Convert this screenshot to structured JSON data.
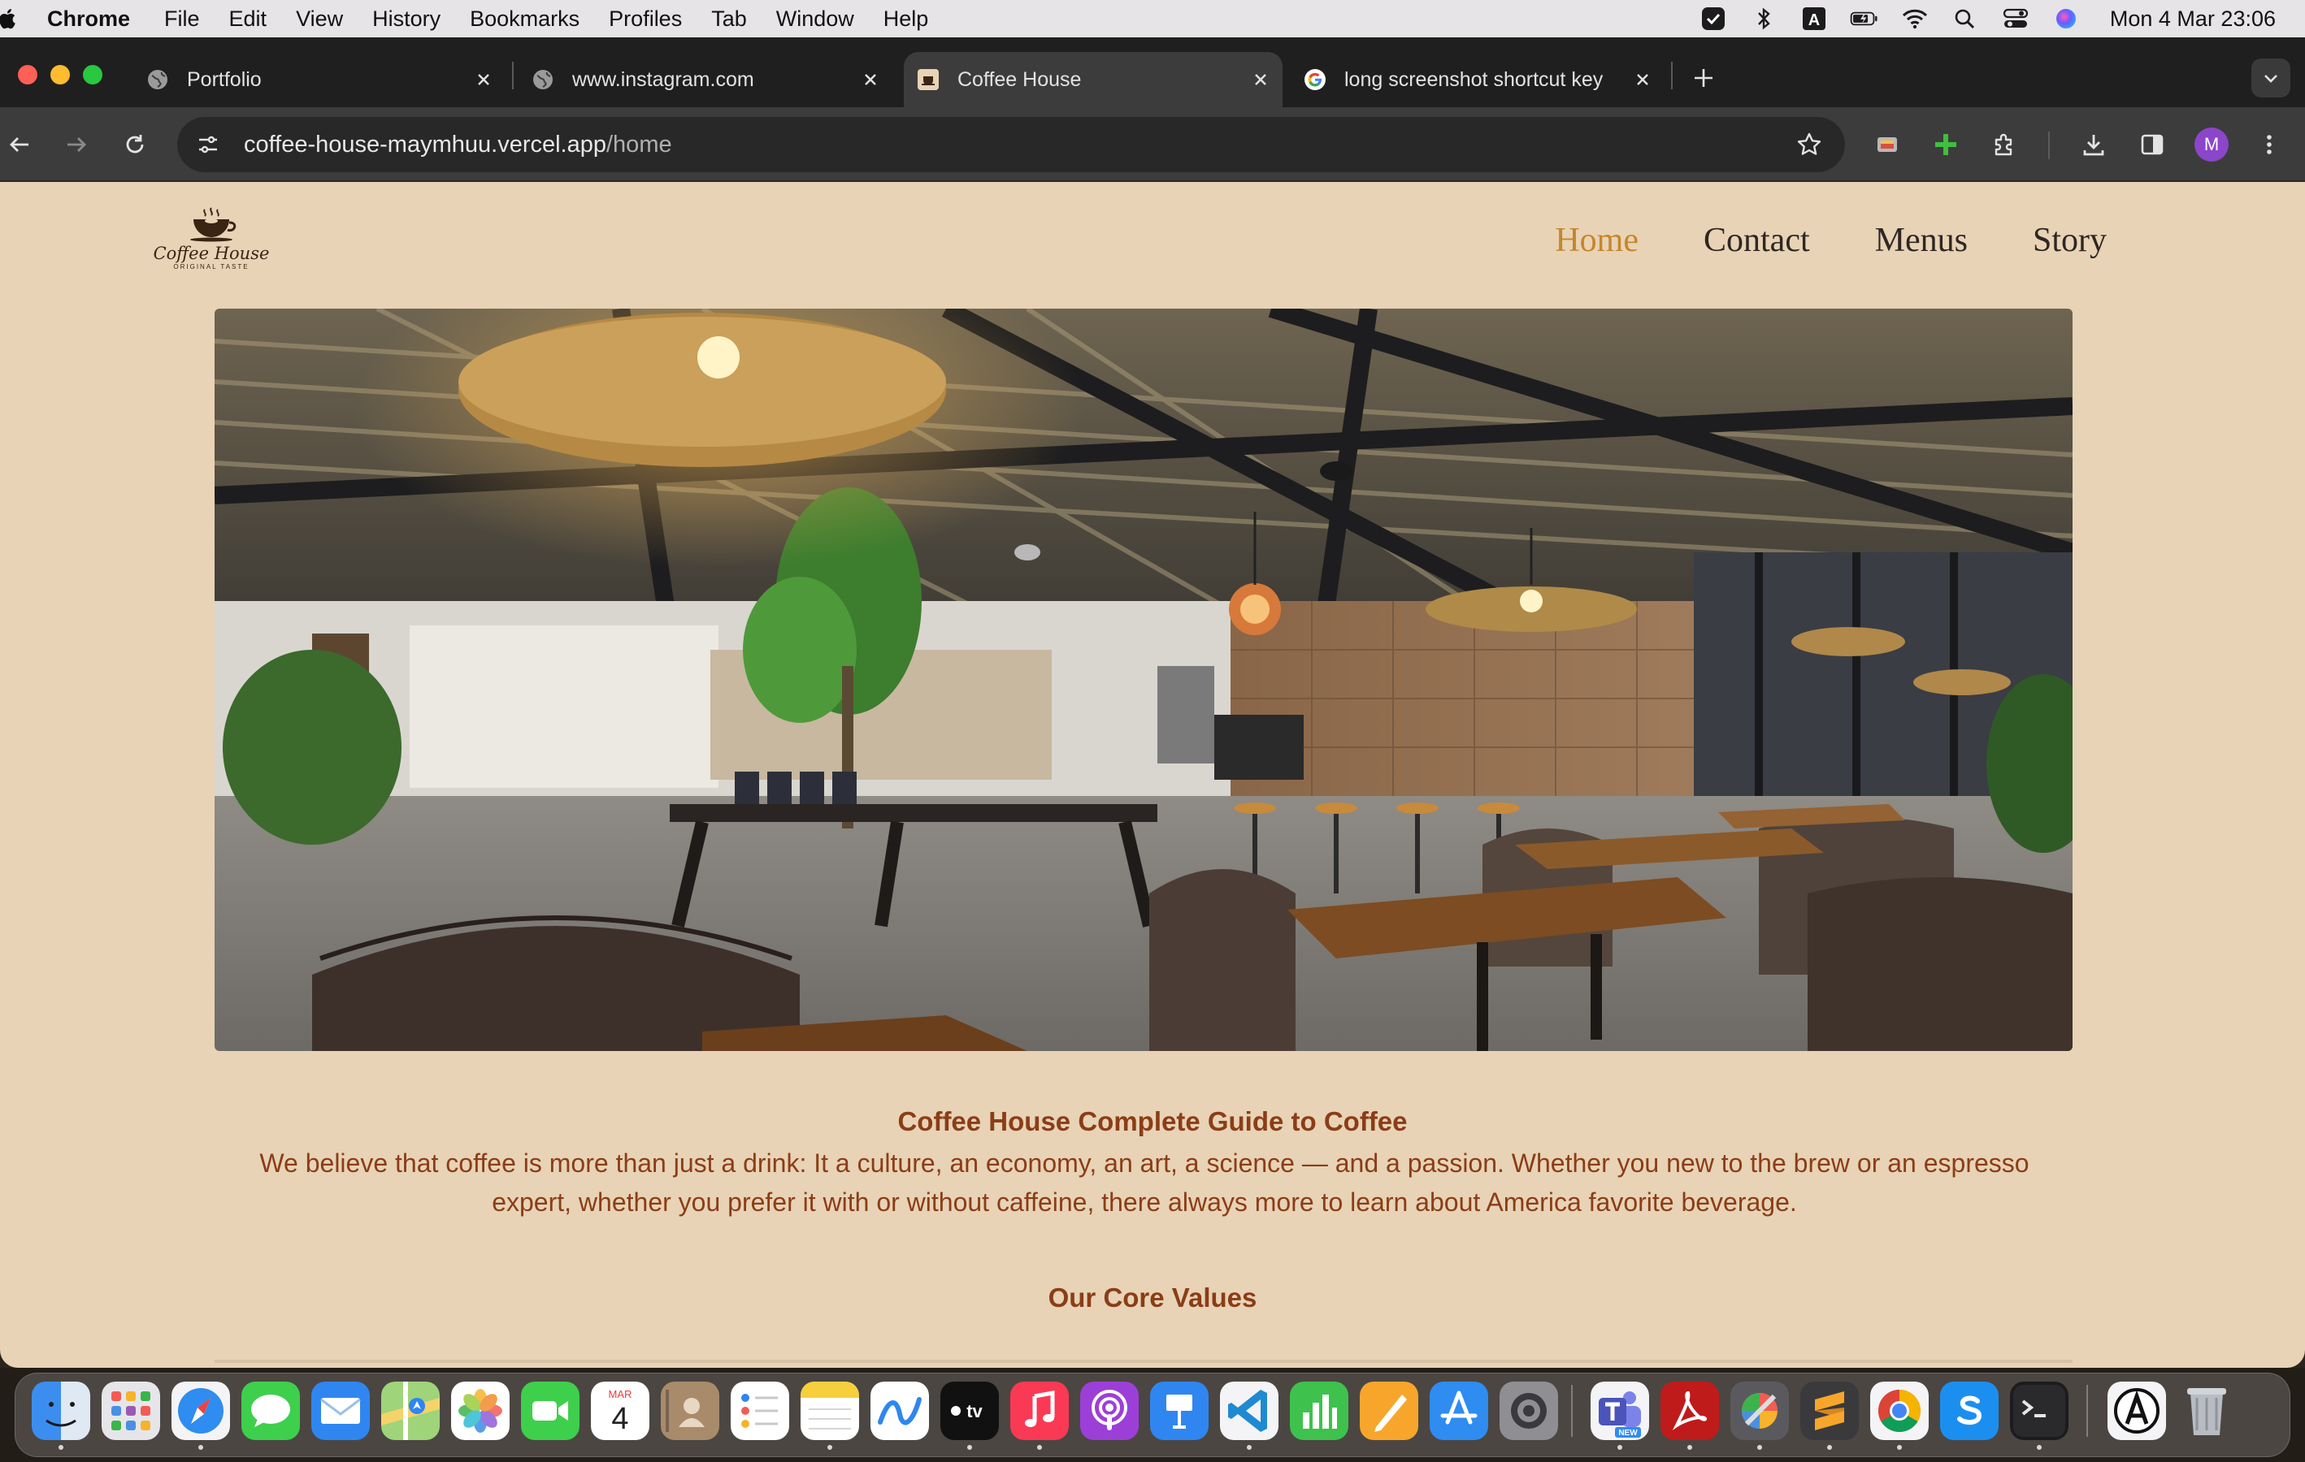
{
  "menubar": {
    "apple_icon": "apple-logo-icon",
    "app_name": "Chrome",
    "items": [
      "File",
      "Edit",
      "View",
      "History",
      "Bookmarks",
      "Profiles",
      "Tab",
      "Window",
      "Help"
    ],
    "status_icons": [
      "control-center-check-icon",
      "bluetooth-icon",
      "input-source-icon",
      "battery-icon",
      "wifi-icon",
      "spotlight-icon",
      "control-center-icon",
      "siri-icon"
    ],
    "input_source_label": "A",
    "clock": "Mon 4 Mar  23:06"
  },
  "tabs": [
    {
      "title": "Portfolio",
      "favicon": "globe-icon",
      "active": false
    },
    {
      "title": "www.instagram.com",
      "favicon": "globe-icon",
      "active": false
    },
    {
      "title": "Coffee House",
      "favicon": "coffee-house-favicon",
      "active": true
    },
    {
      "title": "long screenshot shortcut key",
      "favicon": "google-icon",
      "active": false
    }
  ],
  "toolbar": {
    "url_host": "coffee-house-maymhuu.vercel.app",
    "url_path": "/home",
    "profile_initial": "M"
  },
  "page": {
    "logo": {
      "name": "Coffee House",
      "tagline": "ORIGINAL TASTE"
    },
    "nav": [
      {
        "label": "Home",
        "active": true
      },
      {
        "label": "Contact",
        "active": false
      },
      {
        "label": "Menus",
        "active": false
      },
      {
        "label": "Story",
        "active": false
      }
    ],
    "hero_image": "coffee-shop-interior-photo",
    "guide_title": "Coffee House Complete Guide to Coffee",
    "guide_body": "We believe that coffee is more than just a drink: It a culture, an economy, an art, a science — and a passion. Whether you new to the brew or an espresso expert, whether you prefer it with or without caffeine, there always more to learn about America favorite beverage.",
    "values_title": "Our Core Values",
    "colors": {
      "background": "#e8d3b6",
      "accent": "#c6862b",
      "heading": "#8b3d17",
      "nav_text": "#2e2723"
    }
  },
  "dock": {
    "apps": [
      "Finder",
      "Launchpad",
      "Safari",
      "Messages",
      "Mail",
      "Maps",
      "Photos",
      "FaceTime",
      "Calendar",
      "Contacts",
      "Reminders",
      "Notes",
      "Freeform",
      "TV",
      "Music",
      "Podcasts",
      "Keynote",
      "Visual Studio Code",
      "Numbers",
      "Pages",
      "App Store",
      "System Settings",
      "Microsoft Teams",
      "Adobe Acrobat",
      "ColorSync Utility",
      "Sublime Text",
      "Google Chrome",
      "Skype",
      "Terminal",
      "Font Book",
      "Trash"
    ],
    "calendar_month": "MAR",
    "calendar_day": "4",
    "tv_label": "tv",
    "teams_badge": "NEW"
  }
}
